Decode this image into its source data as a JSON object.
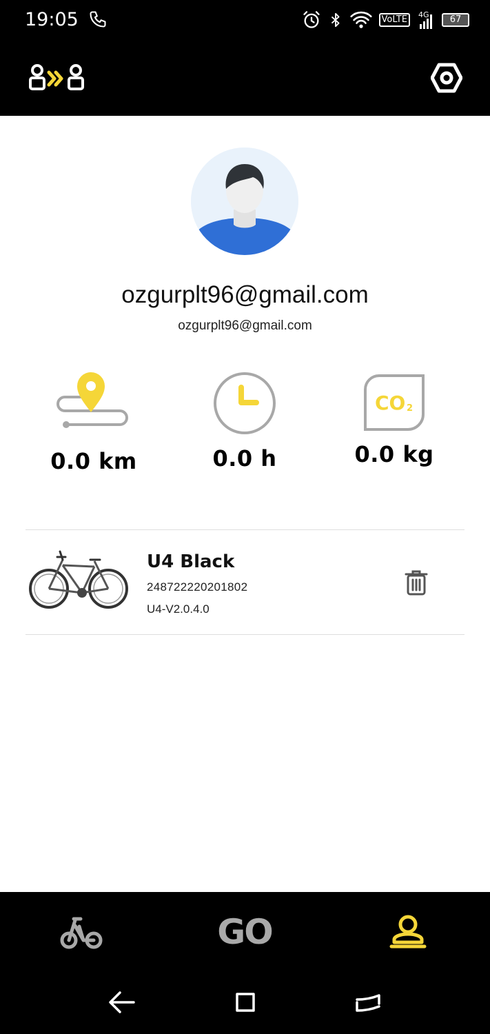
{
  "status_bar": {
    "time": "19:05",
    "network": "VoLTE",
    "signal_type": "4G",
    "battery": "67",
    "icons": [
      "phone-call-icon",
      "alarm-icon",
      "bluetooth-icon",
      "wifi-icon",
      "signal-icon",
      "battery-icon"
    ]
  },
  "header": {
    "left_icon": "share-users-icon",
    "right_icon": "settings-hex-icon"
  },
  "profile": {
    "username": "ozgurplt96@gmail.com",
    "email": "ozgurplt96@gmail.com",
    "avatar_icon": "default-avatar"
  },
  "stats": [
    {
      "icon": "route-pin-icon",
      "value": "0.0 km"
    },
    {
      "icon": "clock-icon",
      "value": "0.0 h"
    },
    {
      "icon": "co2-leaf-icon",
      "value": "0.0 kg"
    }
  ],
  "bike": {
    "name": "U4 Black",
    "serial": "248722220201802",
    "firmware": "U4-V2.0.4.0",
    "image": "bicycle-image",
    "delete_icon": "trash-icon"
  },
  "bottom_nav": {
    "items": [
      {
        "icon": "bike-icon",
        "label": "",
        "active": false
      },
      {
        "icon": "go-icon",
        "label": "GO",
        "active": false
      },
      {
        "icon": "profile-icon",
        "label": "",
        "active": true
      }
    ]
  },
  "colors": {
    "accent": "#f5d638",
    "background": "#ffffff",
    "bar": "#000000",
    "icon_gray": "#a8a8a8"
  },
  "system_nav": [
    "back-icon",
    "recents-icon",
    "home-icon"
  ]
}
